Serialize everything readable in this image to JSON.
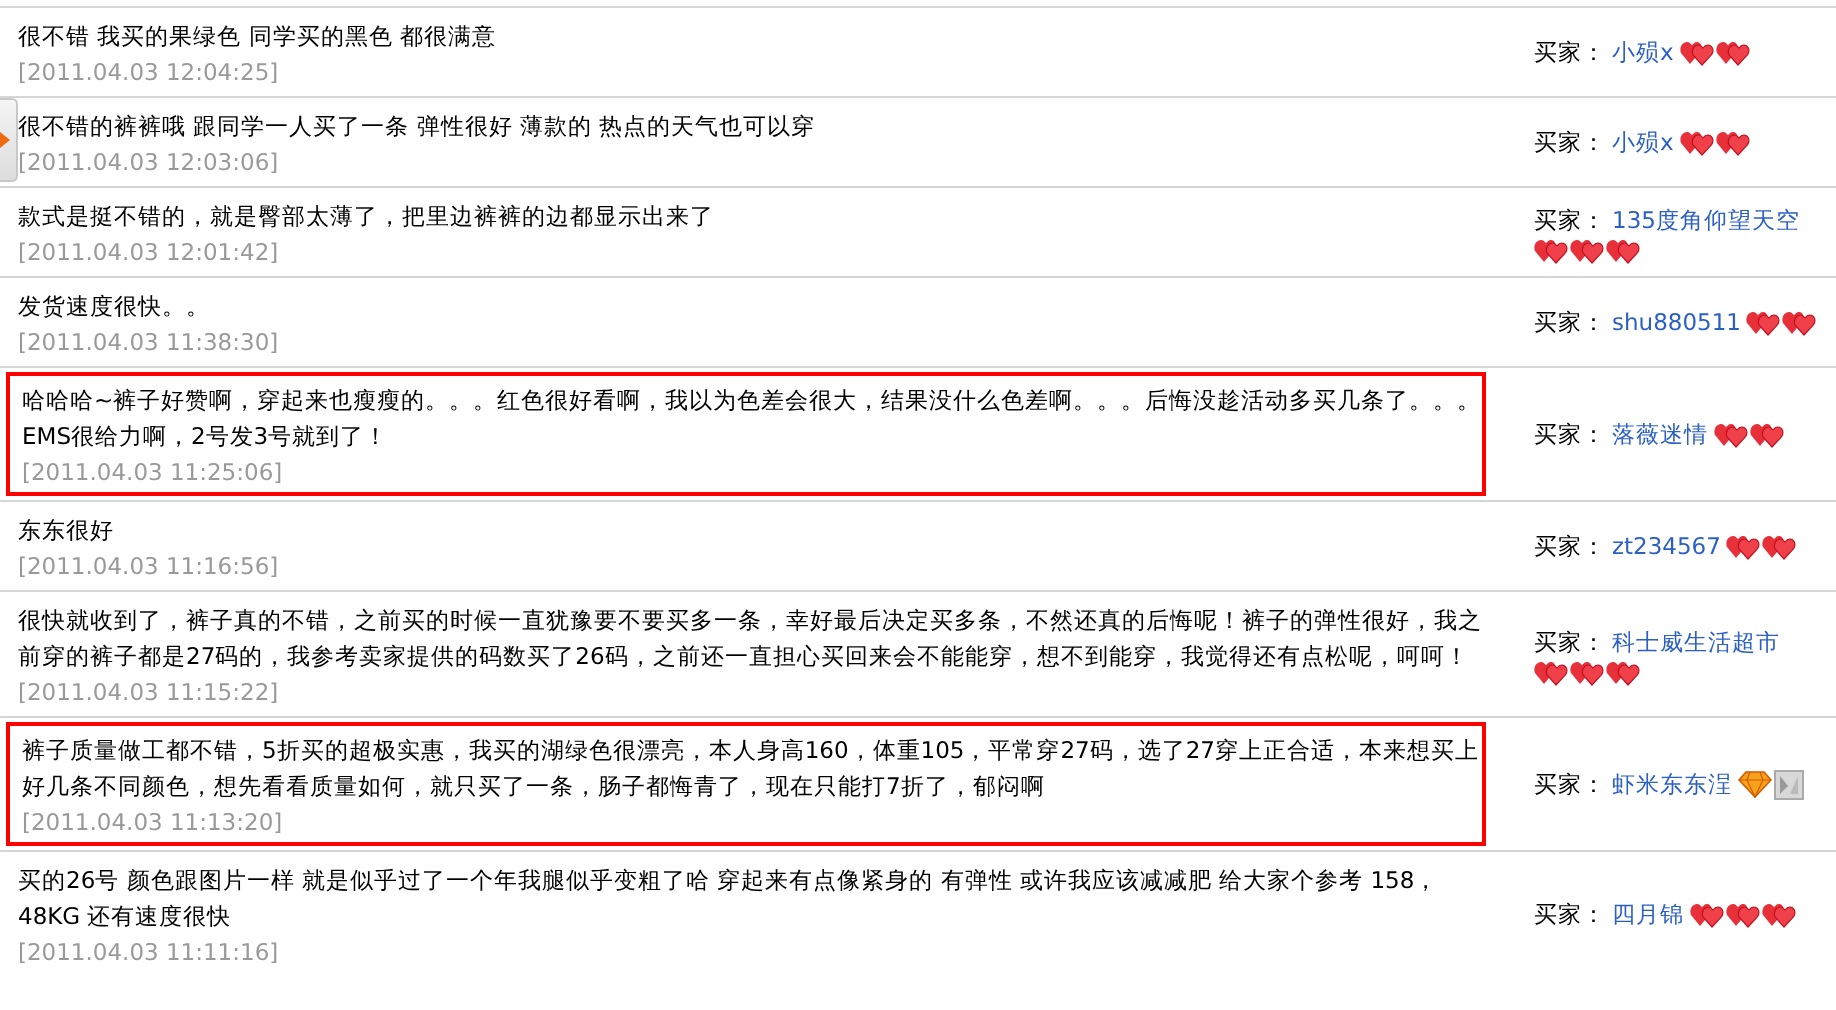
{
  "reviews": [
    {
      "comment": "很不错 我买的果绿色 同学买的黑色 都很满意",
      "date": "[2011.04.03 12:04:25]",
      "highlighted": false,
      "side_tab": false,
      "buyer_label": "买家：",
      "buyer": "小殒x",
      "rank_icons": [
        {
          "kind": "heart"
        },
        {
          "kind": "heart"
        }
      ]
    },
    {
      "comment": "很不错的裤裤哦 跟同学一人买了一条 弹性很好 薄款的 热点的天气也可以穿",
      "date": "[2011.04.03 12:03:06]",
      "highlighted": false,
      "side_tab": true,
      "buyer_label": "买家：",
      "buyer": "小殒x",
      "rank_icons": [
        {
          "kind": "heart"
        },
        {
          "kind": "heart"
        }
      ]
    },
    {
      "comment": "款式是挺不错的，就是臀部太薄了，把里边裤裤的边都显示出来了",
      "date": "[2011.04.03 12:01:42]",
      "highlighted": false,
      "side_tab": false,
      "buyer_label": "买家：",
      "buyer": "135度角仰望天空",
      "rank_icons": [
        {
          "kind": "heart"
        },
        {
          "kind": "heart"
        },
        {
          "kind": "heart"
        }
      ]
    },
    {
      "comment": "发货速度很快。。",
      "date": "[2011.04.03 11:38:30]",
      "highlighted": false,
      "side_tab": false,
      "buyer_label": "买家：",
      "buyer": "shu880511",
      "rank_icons": [
        {
          "kind": "heart"
        },
        {
          "kind": "heart"
        }
      ]
    },
    {
      "comment": "哈哈哈~裤子好赞啊，穿起来也瘦瘦的。。。红色很好看啊，我以为色差会很大，结果没什么色差啊。。。后悔没趁活动多买几条了。。。EMS很给力啊，2号发3号就到了！",
      "date": "[2011.04.03 11:25:06]",
      "highlighted": true,
      "side_tab": false,
      "buyer_label": "买家：",
      "buyer": "落薇迷情",
      "rank_icons": [
        {
          "kind": "heart"
        },
        {
          "kind": "heart"
        }
      ]
    },
    {
      "comment": "东东很好",
      "date": "[2011.04.03 11:16:56]",
      "highlighted": false,
      "side_tab": false,
      "buyer_label": "买家：",
      "buyer": "zt234567",
      "rank_icons": [
        {
          "kind": "heart"
        },
        {
          "kind": "heart"
        }
      ]
    },
    {
      "comment": "很快就收到了，裤子真的不错，之前买的时候一直犹豫要不要买多一条，幸好最后决定买多条，不然还真的后悔呢！裤子的弹性很好，我之前穿的裤子都是27码的，我参考卖家提供的码数买了26码，之前还一直担心买回来会不能能穿，想不到能穿，我觉得还有点松呢，呵呵！",
      "date": "[2011.04.03 11:15:22]",
      "highlighted": false,
      "side_tab": false,
      "buyer_label": "买家：",
      "buyer": "科士威生活超市",
      "rank_icons": [
        {
          "kind": "heart"
        },
        {
          "kind": "heart"
        },
        {
          "kind": "heart"
        }
      ]
    },
    {
      "comment": "裤子质量做工都不错，5折买的超极实惠，我买的湖绿色很漂亮，本人身高160，体重105，平常穿27码，选了27穿上正合适，本来想买上好几条不同颜色，想先看看质量如何，就只买了一条，肠子都悔青了，现在只能打7折了，郁闷啊",
      "date": "[2011.04.03 11:13:20]",
      "highlighted": true,
      "side_tab": false,
      "buyer_label": "买家：",
      "buyer": "虾米东东浧",
      "rank_icons": [
        {
          "kind": "diamond"
        },
        {
          "kind": "badge"
        }
      ]
    },
    {
      "comment": "买的26号 颜色跟图片一样 就是似乎过了一个年我腿似乎变粗了哈 穿起来有点像紧身的 有弹性 或许我应该减减肥 给大家个参考 158，48KG 还有速度很快",
      "date": "[2011.04.03 11:11:16]",
      "highlighted": false,
      "side_tab": false,
      "buyer_label": "买家：",
      "buyer": "四月锦",
      "rank_icons": [
        {
          "kind": "heart"
        },
        {
          "kind": "heart"
        },
        {
          "kind": "heart"
        }
      ]
    }
  ]
}
